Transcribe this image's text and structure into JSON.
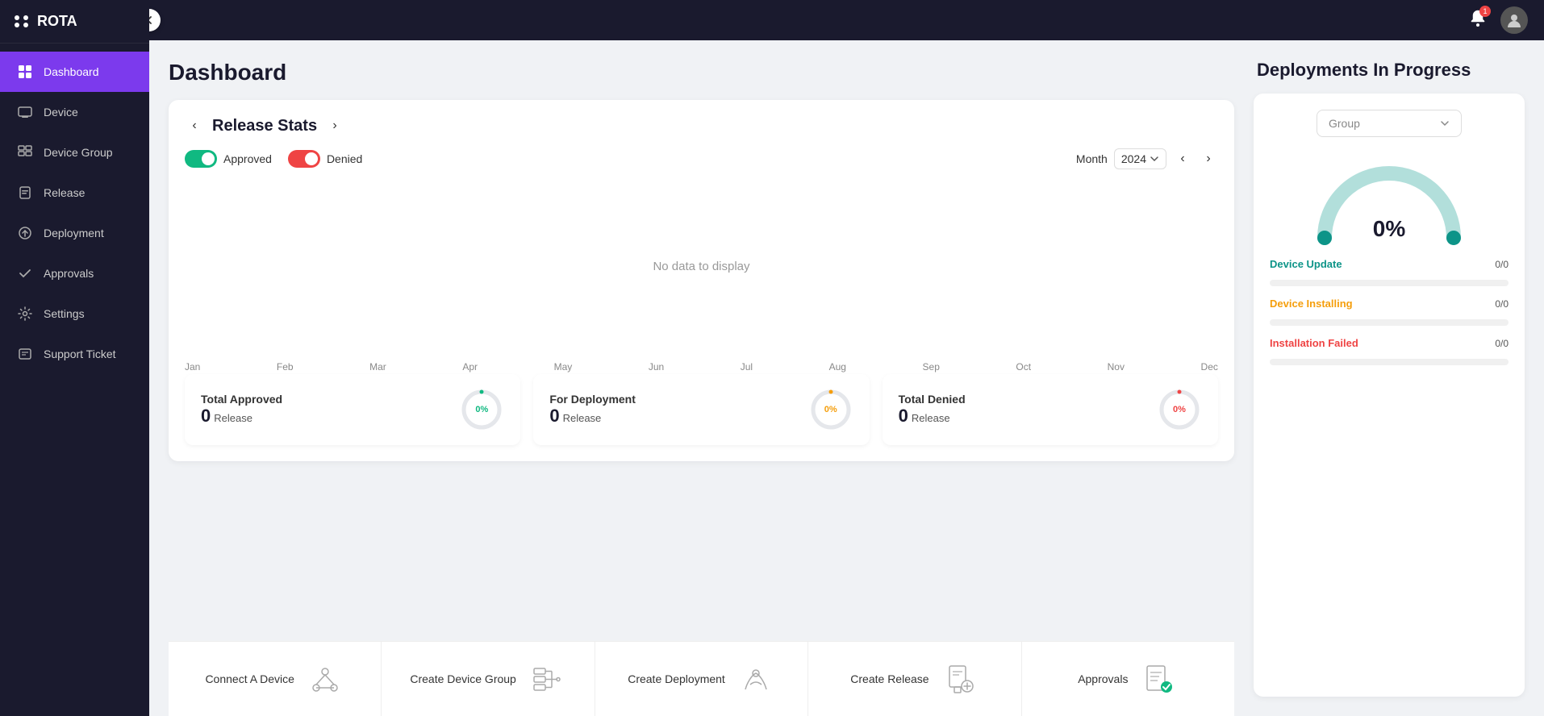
{
  "app": {
    "name": "ROTA"
  },
  "sidebar": {
    "collapse_label": "‹",
    "items": [
      {
        "id": "dashboard",
        "label": "Dashboard",
        "active": true
      },
      {
        "id": "device",
        "label": "Device",
        "active": false
      },
      {
        "id": "device-group",
        "label": "Device Group",
        "active": false
      },
      {
        "id": "release",
        "label": "Release",
        "active": false
      },
      {
        "id": "deployment",
        "label": "Deployment",
        "active": false
      },
      {
        "id": "approvals",
        "label": "Approvals",
        "active": false
      },
      {
        "id": "settings",
        "label": "Settings",
        "active": false
      },
      {
        "id": "support-ticket",
        "label": "Support Ticket",
        "active": false
      }
    ]
  },
  "topbar": {
    "notification_count": "1"
  },
  "page": {
    "title": "Dashboard"
  },
  "release_stats": {
    "title": "Release Stats",
    "approved_label": "Approved",
    "denied_label": "Denied",
    "month_label": "Month",
    "year": "2024",
    "no_data": "No data to display",
    "months": [
      "Jan",
      "Feb",
      "Mar",
      "Apr",
      "May",
      "Jun",
      "Jul",
      "Aug",
      "Sep",
      "Oct",
      "Nov",
      "Dec"
    ]
  },
  "stat_boxes": [
    {
      "id": "total-approved",
      "label": "Total Approved",
      "count": "0",
      "sub": "Release",
      "percent": "0%",
      "color": "#10b981"
    },
    {
      "id": "for-deployment",
      "label": "For Deployment",
      "count": "0",
      "sub": "Release",
      "percent": "0%",
      "color": "#f59e0b"
    },
    {
      "id": "total-denied",
      "label": "Total Denied",
      "count": "0",
      "sub": "Release",
      "percent": "0%",
      "color": "#ef4444"
    }
  ],
  "action_cards": [
    {
      "id": "connect-device",
      "label": "Connect A Device"
    },
    {
      "id": "create-device-group",
      "label": "Create Device Group"
    },
    {
      "id": "create-deployment",
      "label": "Create Deployment"
    },
    {
      "id": "create-release",
      "label": "Create Release"
    },
    {
      "id": "approvals",
      "label": "Approvals"
    }
  ],
  "deployments": {
    "title": "Deployments In Progress",
    "group_placeholder": "Group",
    "gauge_percent": "0%",
    "items": [
      {
        "id": "device-update",
        "label": "Device Update",
        "count": "0/0",
        "color": "teal"
      },
      {
        "id": "device-installing",
        "label": "Device Installing",
        "count": "0/0",
        "color": "orange"
      },
      {
        "id": "installation-failed",
        "label": "Installation Failed",
        "count": "0/0",
        "color": "red"
      }
    ]
  }
}
